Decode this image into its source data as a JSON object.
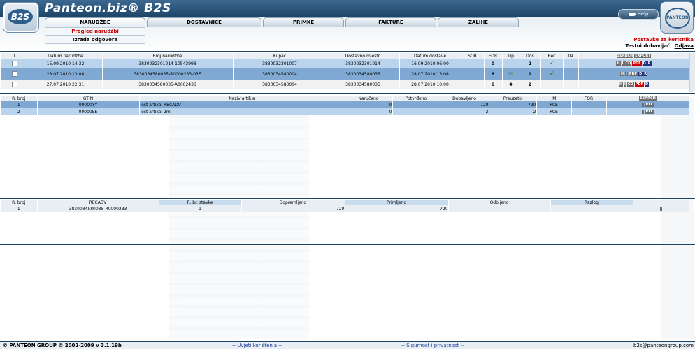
{
  "header": {
    "logo_text": "B2S",
    "brand": "Panteon.biz® B2S",
    "help_label": "Help",
    "partner_logo": "PANTEON",
    "tabs": [
      {
        "label": "NARUDŽBE"
      },
      {
        "label": "DOSTAVNICE"
      },
      {
        "label": "PRIMKE"
      },
      {
        "label": "FAKTURE"
      },
      {
        "label": "ZALIHE"
      }
    ],
    "submenu": [
      {
        "label": "Pregled narudžbi"
      },
      {
        "label": "Izrada odgovora"
      }
    ],
    "user_settings": "Postavke za korisnika",
    "user_name": "Testni dobavljač",
    "logout": "Odjava"
  },
  "orders": {
    "columns": [
      "I",
      "Datum narudžbe",
      "Broj narudžbe",
      "Kupac",
      "Dostavno mjesto",
      "Datum dostave",
      "SOR",
      "FOR",
      "Tip",
      "Dos",
      "Rec",
      "IN",
      ""
    ],
    "actions": {
      "search": "SEARCH",
      "export": "EXPORT"
    },
    "rows": [
      {
        "date": "15.09.2010 14:32",
        "number": "3830032301014-10543998",
        "buyer": "3830032301007",
        "place": "3830032301014",
        "delivery": "16.09.2010 06:00",
        "sor": "",
        "for": "0",
        "tip": "",
        "dos": "2",
        "rec": "✓",
        "in": ""
      },
      {
        "date": "28.07.2010 13:08",
        "number": "3830034580035-R0000233-03E",
        "buyer": "3830034580004",
        "place": "3830034580035",
        "delivery": "28.07.2010 13:08",
        "sor": "",
        "for": "6",
        "tip": "29",
        "dos": "2",
        "rec": "✓",
        "in": ""
      },
      {
        "date": "27.07.2010 22:31",
        "number": "3830034580035-A0002436",
        "buyer": "3830034580004",
        "place": "3830034580035",
        "delivery": "28.07.2010 10:00",
        "sor": "",
        "for": "6",
        "tip": "4",
        "dos": "2",
        "rec": "",
        "in": ""
      }
    ]
  },
  "items": {
    "columns": [
      "R. broj",
      "GTIN",
      "Naziv artikla",
      "Naručeno",
      "Potvrđeno",
      "Dobavljeno",
      "Preuzeto",
      "JM",
      "FOR"
    ],
    "search_label": "SEARCH",
    "rows": [
      {
        "rb": "1",
        "gtin": "00000YY",
        "name": "Test artikal RECADV",
        "ordered": "0",
        "confirmed": "",
        "supplied": "720",
        "taken": "720",
        "jm": "PCE",
        "for": ""
      },
      {
        "rb": "2",
        "gtin": "00000EE",
        "name": "Test artikal 2m",
        "ordered": "0",
        "confirmed": "",
        "supplied": "2",
        "taken": "2",
        "jm": "PCE",
        "for": ""
      }
    ]
  },
  "recadv": {
    "columns": [
      "R. broj",
      "RECADV",
      "R. br. stavke",
      "Dopremljeno",
      "Primljeno",
      "Odbijeno",
      "Razlog"
    ],
    "rows": [
      {
        "rb": "1",
        "recadv": "3830034580035-R0000233",
        "item": "1",
        "delivered": "720",
        "received": "720",
        "rejected": "",
        "reason": ""
      }
    ]
  },
  "buttons": {
    "h": "H",
    "i": "I",
    "co": "CO",
    "pdf": "PDF",
    "d": "D",
    "r": "R",
    "rec": "REC"
  },
  "footer": {
    "copyright": "© PANTEON GROUP © 2002-2009 v 3.1.19b",
    "terms": "-- Uvjeti korištenja --",
    "privacy": "-- Sigurnost i privatnost --",
    "email": "b2s@panteongroup.com"
  },
  "colors": {
    "navy": "#1d4568",
    "row_blue": "#b9d4ec",
    "row_selected": "#7fa9d2",
    "accent_red": "#c80000"
  }
}
